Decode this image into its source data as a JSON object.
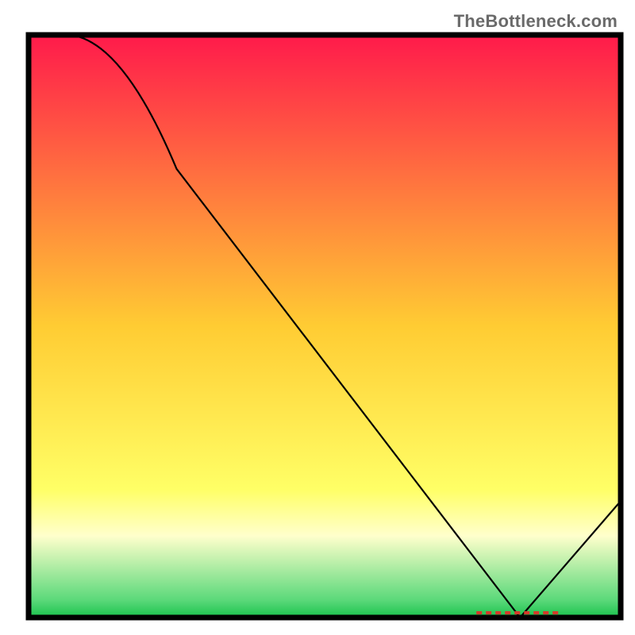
{
  "attribution": "TheBottleneck.com",
  "chart_data": {
    "type": "line",
    "title": "",
    "xlabel": "",
    "ylabel": "",
    "xlim": [
      0,
      100
    ],
    "ylim": [
      0,
      100
    ],
    "series": [
      {
        "name": "curve",
        "x": [
          5,
          25,
          83,
          100
        ],
        "y": [
          100,
          77,
          0,
          20
        ]
      }
    ],
    "min_marker": {
      "x": 83,
      "y": 0
    },
    "gradient_stops": [
      {
        "pos": 0.0,
        "color": "#ff1a4b"
      },
      {
        "pos": 0.5,
        "color": "#ffcc33"
      },
      {
        "pos": 0.78,
        "color": "#ffff66"
      },
      {
        "pos": 0.86,
        "color": "#ffffcc"
      },
      {
        "pos": 0.97,
        "color": "#5bd97a"
      },
      {
        "pos": 1.0,
        "color": "#19c24d"
      }
    ]
  }
}
